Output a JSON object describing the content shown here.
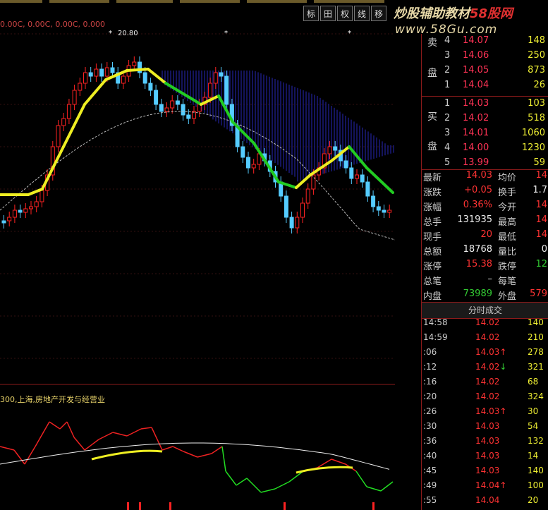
{
  "topbar_info": "0.00C, 0.00C, 0.00C, 0.000",
  "high_marker": "20.80",
  "toolbar": [
    "标",
    "田",
    "权",
    "线",
    "移"
  ],
  "watermark": {
    "main": "炒股辅助教材",
    "brand": "58股网",
    "url": "www.58Gu.com"
  },
  "sub_label": "300,上海,房地产开发与经营业",
  "order_book": {
    "sell_label_top": "卖",
    "sell_label_bottom": "盘",
    "buy_label_top": "买",
    "buy_label_bottom": "盘",
    "sell": [
      {
        "idx": "4",
        "price": "14.07",
        "vol": "148"
      },
      {
        "idx": "3",
        "price": "14.06",
        "vol": "250"
      },
      {
        "idx": "2",
        "price": "14.05",
        "vol": "873"
      },
      {
        "idx": "1",
        "price": "14.04",
        "vol": "26"
      }
    ],
    "buy": [
      {
        "idx": "1",
        "price": "14.03",
        "vol": "103"
      },
      {
        "idx": "2",
        "price": "14.02",
        "vol": "518"
      },
      {
        "idx": "3",
        "price": "14.01",
        "vol": "1060"
      },
      {
        "idx": "4",
        "price": "14.00",
        "vol": "1230"
      },
      {
        "idx": "5",
        "price": "13.99",
        "vol": "59"
      }
    ]
  },
  "stats": [
    {
      "l1": "最新",
      "v1": "14.03",
      "c1": "red",
      "l2": "均价",
      "v2": "14",
      "c2": "red"
    },
    {
      "l1": "涨跌",
      "v1": "+0.05",
      "c1": "red",
      "l2": "换手",
      "v2": "1.7",
      "c2": "white"
    },
    {
      "l1": "涨幅",
      "v1": "0.36%",
      "c1": "red",
      "l2": "今开",
      "v2": "14",
      "c2": "red"
    },
    {
      "l1": "总手",
      "v1": "131935",
      "c1": "white",
      "l2": "最高",
      "v2": "14",
      "c2": "red"
    },
    {
      "l1": "现手",
      "v1": "20",
      "c1": "red",
      "l2": "最低",
      "v2": "14",
      "c2": "red"
    },
    {
      "l1": "总额",
      "v1": "18768",
      "c1": "white",
      "l2": "量比",
      "v2": "0",
      "c2": "white"
    },
    {
      "l1": "涨停",
      "v1": "15.38",
      "c1": "red",
      "l2": "跌停",
      "v2": "12",
      "c2": "green"
    },
    {
      "l1": "总笔",
      "v1": "–",
      "c1": "white",
      "l2": "每笔",
      "v2": "",
      "c2": "white"
    },
    {
      "l1": "内盘",
      "v1": "73989",
      "c1": "green",
      "l2": "外盘",
      "v2": "579",
      "c2": "red"
    }
  ],
  "ticks_header": "分时成交",
  "ticks": [
    {
      "time": "14:58",
      "price": "14.02",
      "arrow": "",
      "vol": "140"
    },
    {
      "time": "14:59",
      "price": "14.02",
      "arrow": "",
      "vol": "210"
    },
    {
      "time": ":06",
      "price": "14.03",
      "arrow": "↑",
      "vol": "278"
    },
    {
      "time": ":12",
      "price": "14.02",
      "arrow": "↓",
      "vol": "321"
    },
    {
      "time": ":16",
      "price": "14.02",
      "arrow": "",
      "vol": "68"
    },
    {
      "time": ":20",
      "price": "14.02",
      "arrow": "",
      "vol": "324"
    },
    {
      "time": ":26",
      "price": "14.03",
      "arrow": "↑",
      "vol": "30"
    },
    {
      "time": ":30",
      "price": "14.03",
      "arrow": "",
      "vol": "54"
    },
    {
      "time": ":36",
      "price": "14.03",
      "arrow": "",
      "vol": "132"
    },
    {
      "time": ":40",
      "price": "14.03",
      "arrow": "",
      "vol": "14"
    },
    {
      "time": ":45",
      "price": "14.03",
      "arrow": "",
      "vol": "140"
    },
    {
      "time": ":49",
      "price": "14.04",
      "arrow": "↑",
      "vol": "100"
    },
    {
      "time": ":55",
      "price": "14.04",
      "arrow": "",
      "vol": "20"
    }
  ]
}
